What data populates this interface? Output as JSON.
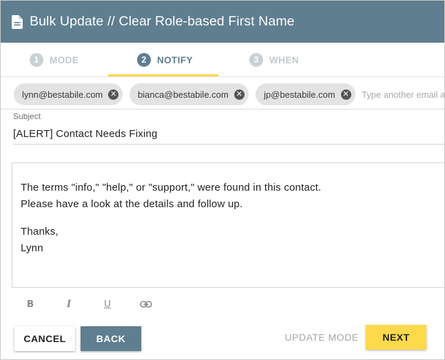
{
  "dialog": {
    "title": "Bulk Update // Clear Role-based First Name",
    "title_icon": "document-icon",
    "header_color": "#5f7e8f"
  },
  "stepper": {
    "steps": [
      {
        "number": "1",
        "label": "MODE",
        "state": "inactive"
      },
      {
        "number": "2",
        "label": "NOTIFY",
        "state": "active"
      },
      {
        "number": "3",
        "label": "WHEN",
        "state": "inactive"
      }
    ],
    "active_indicator_color": "#fdd94c"
  },
  "recipients": {
    "chips": [
      {
        "email": "lynn@bestabile.com"
      },
      {
        "email": "bianca@bestabile.com"
      },
      {
        "email": "jp@bestabile.com"
      }
    ],
    "remove_icon": "close-circle-icon",
    "placeholder": "Type another email a"
  },
  "subject": {
    "label": "Subject",
    "value": "[ALERT] Contact Needs Fixing"
  },
  "message": {
    "line1": "The terms \"info,\" \"help,\" or \"support,\" were found in this contact.",
    "line2": "Please have a look at the details and follow up.",
    "line3": "Thanks,",
    "line4": "Lynn"
  },
  "toolbar": {
    "bold": "B",
    "italic": "I",
    "underline": "U",
    "link_icon": "link-icon"
  },
  "actions": {
    "cancel": "CANCEL",
    "back": "BACK",
    "update_mode": "UPDATE MODE",
    "next": "NEXT"
  }
}
